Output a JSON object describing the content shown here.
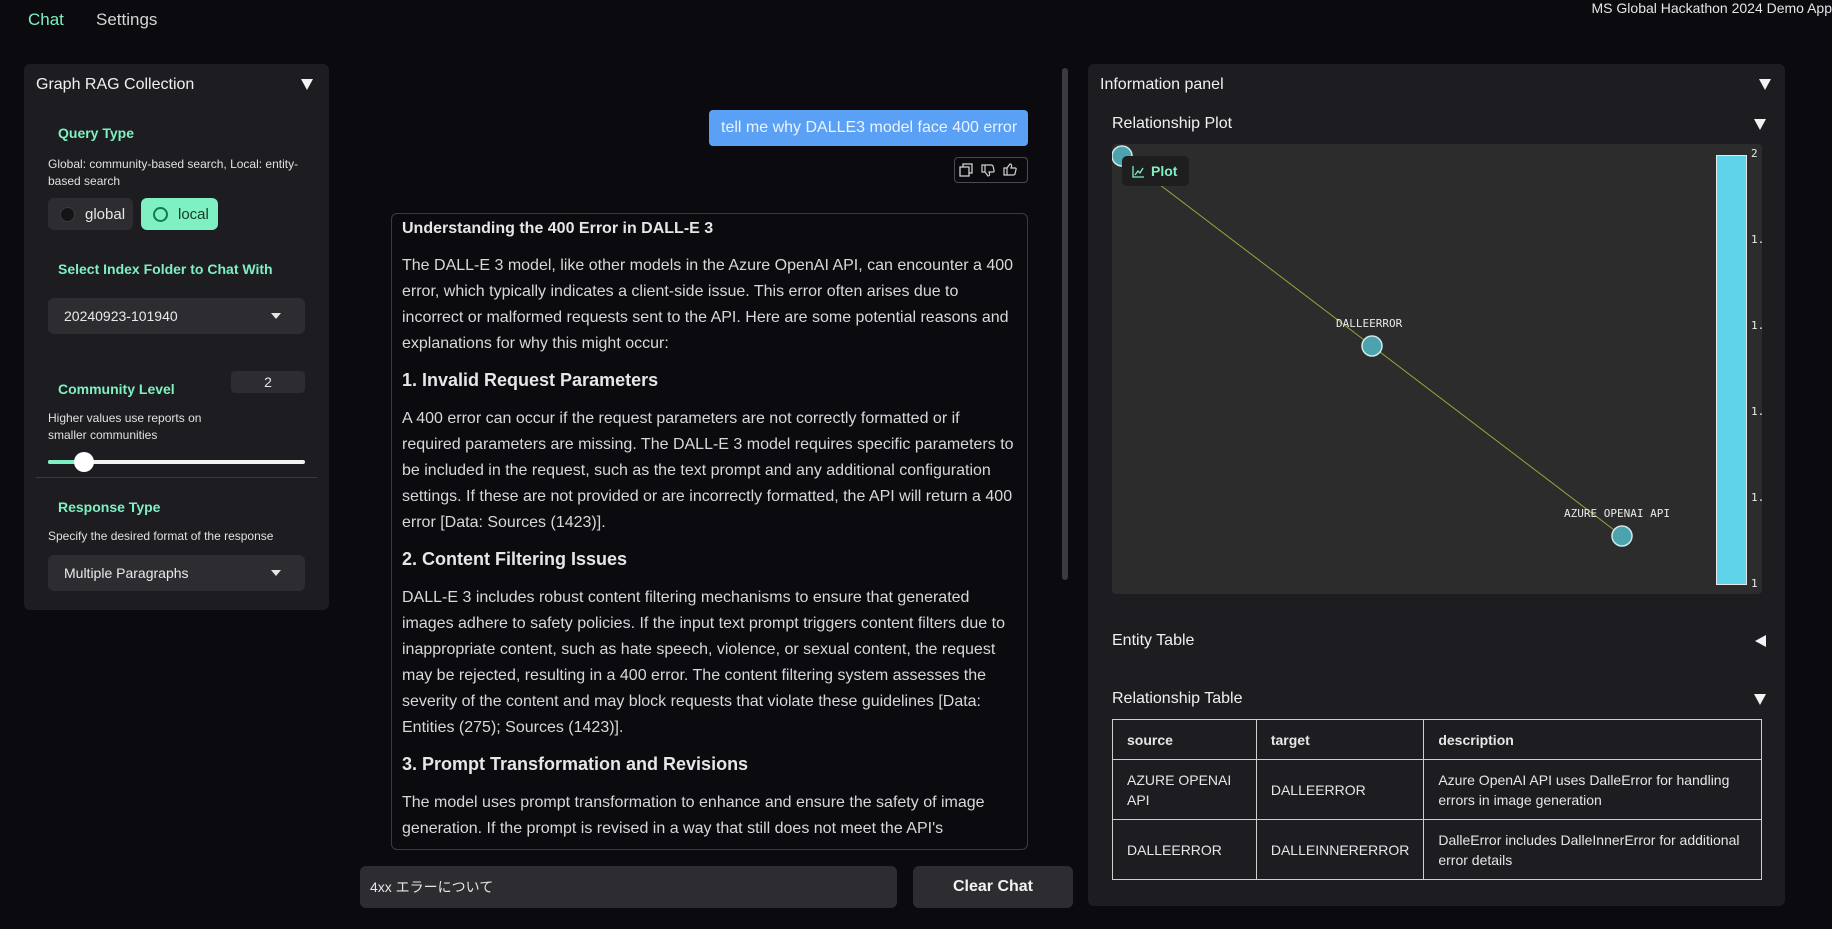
{
  "nav": {
    "tabs": [
      {
        "label": "Chat",
        "active": true
      },
      {
        "label": "Settings",
        "active": false
      }
    ],
    "app_title": "MS Global Hackathon 2024 Demo App"
  },
  "left_panel": {
    "title": "Graph RAG Collection",
    "query_type": {
      "label": "Query Type",
      "help": "Global: community-based search, Local: entity-based search",
      "options": [
        "global",
        "local"
      ],
      "selected": "local"
    },
    "index_folder": {
      "label": "Select Index Folder to Chat With",
      "value": "20240923-101940"
    },
    "community_level": {
      "label": "Community Level",
      "value": "2",
      "help": "Higher values use reports on smaller communities"
    },
    "response_type": {
      "label": "Response Type",
      "help": "Specify the desired format of the response",
      "value": "Multiple Paragraphs"
    }
  },
  "chat": {
    "user_message": "tell me why DALLE3 model face 400 error",
    "answer": {
      "title": "Understanding the 400 Error in DALL-E 3",
      "intro": "The DALL-E 3 model, like other models in the Azure OpenAI API, can encounter a 400 error, which typically indicates a client-side issue. This error often arises due to incorrect or malformed requests sent to the API. Here are some potential reasons and explanations for why this might occur:",
      "sections": [
        {
          "heading": "1. Invalid Request Parameters",
          "body": "A 400 error can occur if the request parameters are not correctly formatted or if required parameters are missing. The DALL-E 3 model requires specific parameters to be included in the request, such as the text prompt and any additional configuration settings. If these are not provided or are incorrectly formatted, the API will return a 400 error [Data: Sources (1423)]."
        },
        {
          "heading": "2. Content Filtering Issues",
          "body": "DALL-E 3 includes robust content filtering mechanisms to ensure that generated images adhere to safety policies. If the input text prompt triggers content filters due to inappropriate content, such as hate speech, violence, or sexual content, the request may be rejected, resulting in a 400 error. The content filtering system assesses the severity of the content and may block requests that violate these guidelines [Data: Entities (275); Sources (1423)]."
        },
        {
          "heading": "3. Prompt Transformation and Revisions",
          "body": "The model uses prompt transformation to enhance and ensure the safety of image generation. If the prompt is revised in a way that still does not meet the API's"
        }
      ]
    },
    "input_value": "4xx エラーについて",
    "clear_label": "Clear Chat"
  },
  "info_panel": {
    "title": "Information panel",
    "relationship_plot": {
      "title": "Relationship Plot",
      "button_label": "Plot",
      "nodes": [
        "DALLEERROR",
        "AZURE OPENAI API"
      ],
      "colorbar_ticks": [
        "2",
        "1.",
        "1.",
        "1.",
        "1.",
        "1"
      ],
      "node_color": "#4aa3ad",
      "edge_color": "#9aa53c"
    },
    "entity_table": {
      "title": "Entity Table"
    },
    "relationship_table": {
      "title": "Relationship Table",
      "columns": [
        "source",
        "target",
        "description"
      ],
      "rows": [
        [
          "AZURE OPENAI API",
          "DALLEERROR",
          "Azure OpenAI API uses DalleError for handling errors in image generation"
        ],
        [
          "DALLEERROR",
          "DALLEINNERERROR",
          "DalleError includes DalleInnerError for additional error details"
        ]
      ]
    }
  },
  "colors": {
    "accent": "#7ff0c2",
    "user_bubble": "#5aa0f5",
    "panel_bg": "#1d1d21",
    "page_bg": "#0b0b0f"
  }
}
